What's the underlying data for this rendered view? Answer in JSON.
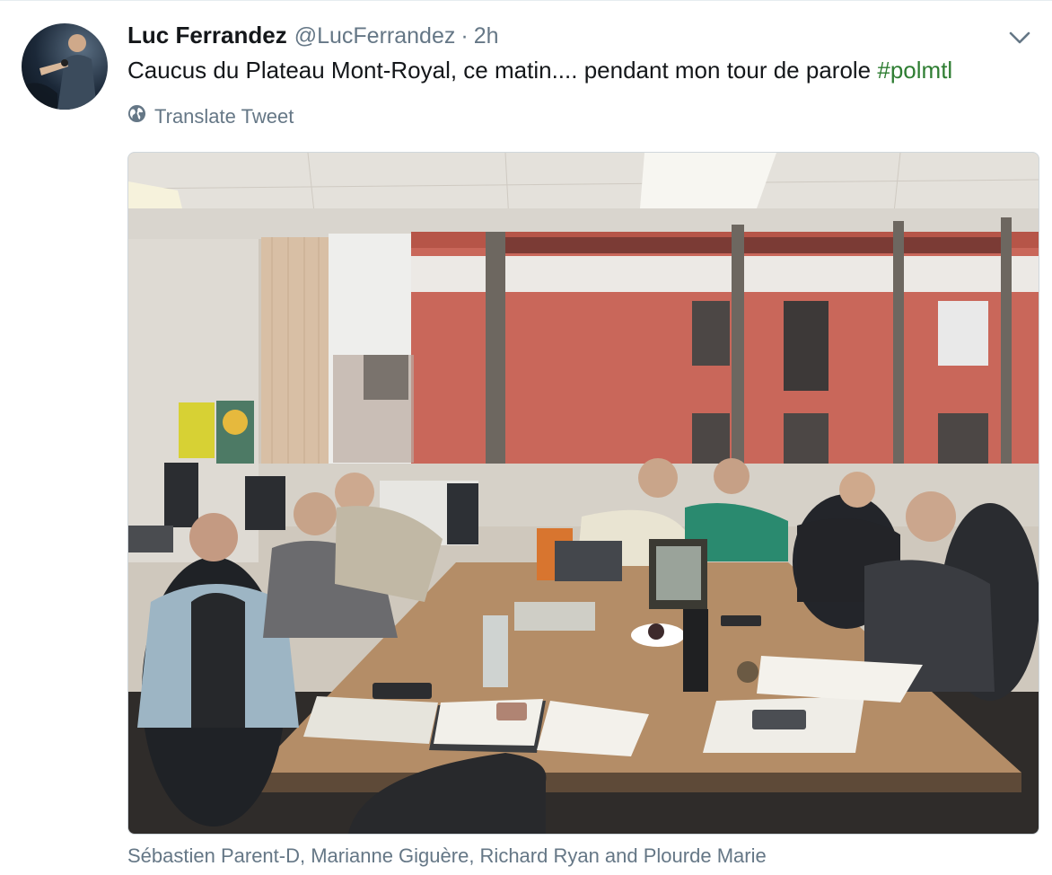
{
  "tweet": {
    "author_name": "Luc Ferrandez",
    "author_handle": "@LucFerrandez",
    "separator": "·",
    "time_ago": "2h",
    "text": "Caucus du Plateau Mont-Royal, ce matin.... pendant mon tour de parole ",
    "hashtag": "#polmtl",
    "translate_label": "Translate Tweet",
    "tagged_people": "Sébastien Parent-D, Marianne Giguère, Richard Ryan and Plourde Marie"
  },
  "icons": {
    "globe": "globe-icon",
    "more": "chevron-down-icon"
  },
  "colors": {
    "hashtag": "#2e7d32",
    "secondary_text": "#657786",
    "primary_text": "#14171a"
  }
}
